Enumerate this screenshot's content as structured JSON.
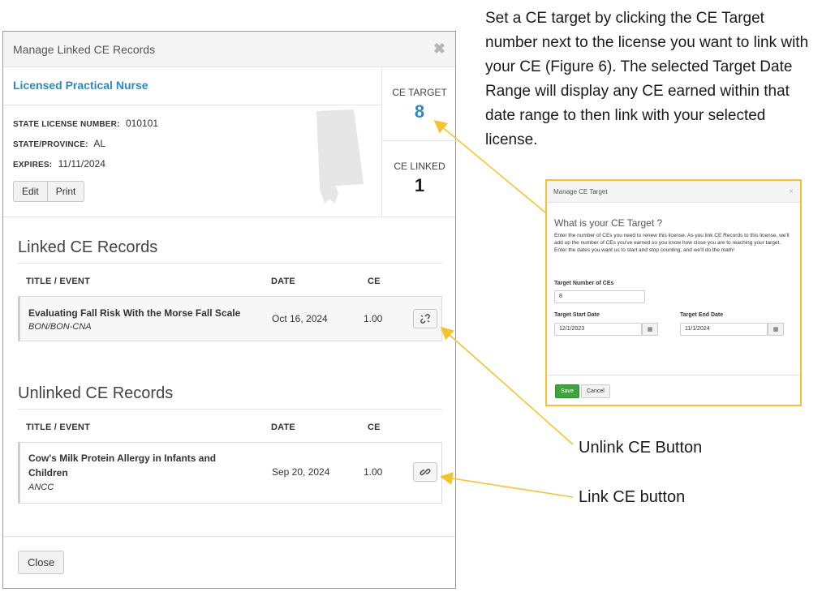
{
  "modal": {
    "title": "Manage Linked CE Records",
    "close_glyph": "✖",
    "license": {
      "name": "Licensed Practical Nurse",
      "fields": [
        {
          "label": "STATE LICENSE NUMBER:",
          "value": "010101"
        },
        {
          "label": "STATE/PROVINCE:",
          "value": "AL"
        },
        {
          "label": "EXPIRES:",
          "value": "11/11/2024"
        }
      ],
      "edit_label": "Edit",
      "print_label": "Print",
      "state_icon": "alabama-state-shape"
    },
    "stats": {
      "ce_target_label": "CE TARGET",
      "ce_target_value": "8",
      "ce_linked_label": "CE LINKED",
      "ce_linked_value": "1"
    },
    "linked": {
      "title": "Linked CE Records",
      "columns": [
        "TITLE / EVENT",
        "DATE",
        "CE"
      ],
      "records": [
        {
          "title": "Evaluating Fall Risk With the Morse Fall Scale",
          "provider": "BON/BON-CNA",
          "date": "Oct 16, 2024",
          "ce": "1.00",
          "action_icon": "unlink-icon"
        }
      ]
    },
    "unlinked": {
      "title": "Unlinked CE Records",
      "columns": [
        "TITLE / EVENT",
        "DATE",
        "CE"
      ],
      "records": [
        {
          "title_line1": "Cow's Milk Protein Allergy in Infants and",
          "title_line2": "Children",
          "provider": "ANCC",
          "date": "Sep 20, 2024",
          "ce": "1.00",
          "action_icon": "link-icon"
        }
      ]
    },
    "close_label": "Close"
  },
  "instructions": "Set a CE target by clicking the CE Target number next to the license you want to link with your CE (Figure 6). The selected Target Date Range will display any CE earned within that date range to then link with your selected license.",
  "callouts": {
    "unlink": "Unlink CE Button",
    "link": "Link CE button"
  },
  "mini_dialog": {
    "title": "Manage CE Target",
    "close_glyph": "×",
    "heading": "What is your CE Target ?",
    "description": "Enter the number of CEs you need to renew this license. As you link CE Records to this license, we'll add up the number of CEs you've earned so you know how close you are to reaching your target. Enter the dates you want us to start and stop counting, and we'll do the math!",
    "target_number_label": "Target Number of CEs",
    "target_number_value": "8",
    "start_date_label": "Target Start Date",
    "start_date_value": "12/1/2023",
    "end_date_label": "Target End Date",
    "end_date_value": "11/1/2024",
    "save_label": "Save",
    "cancel_label": "Cancel"
  },
  "colors": {
    "accent_blue": "#2a8bc2",
    "arrow_yellow": "#f4c430",
    "save_green": "#3fa33f"
  }
}
